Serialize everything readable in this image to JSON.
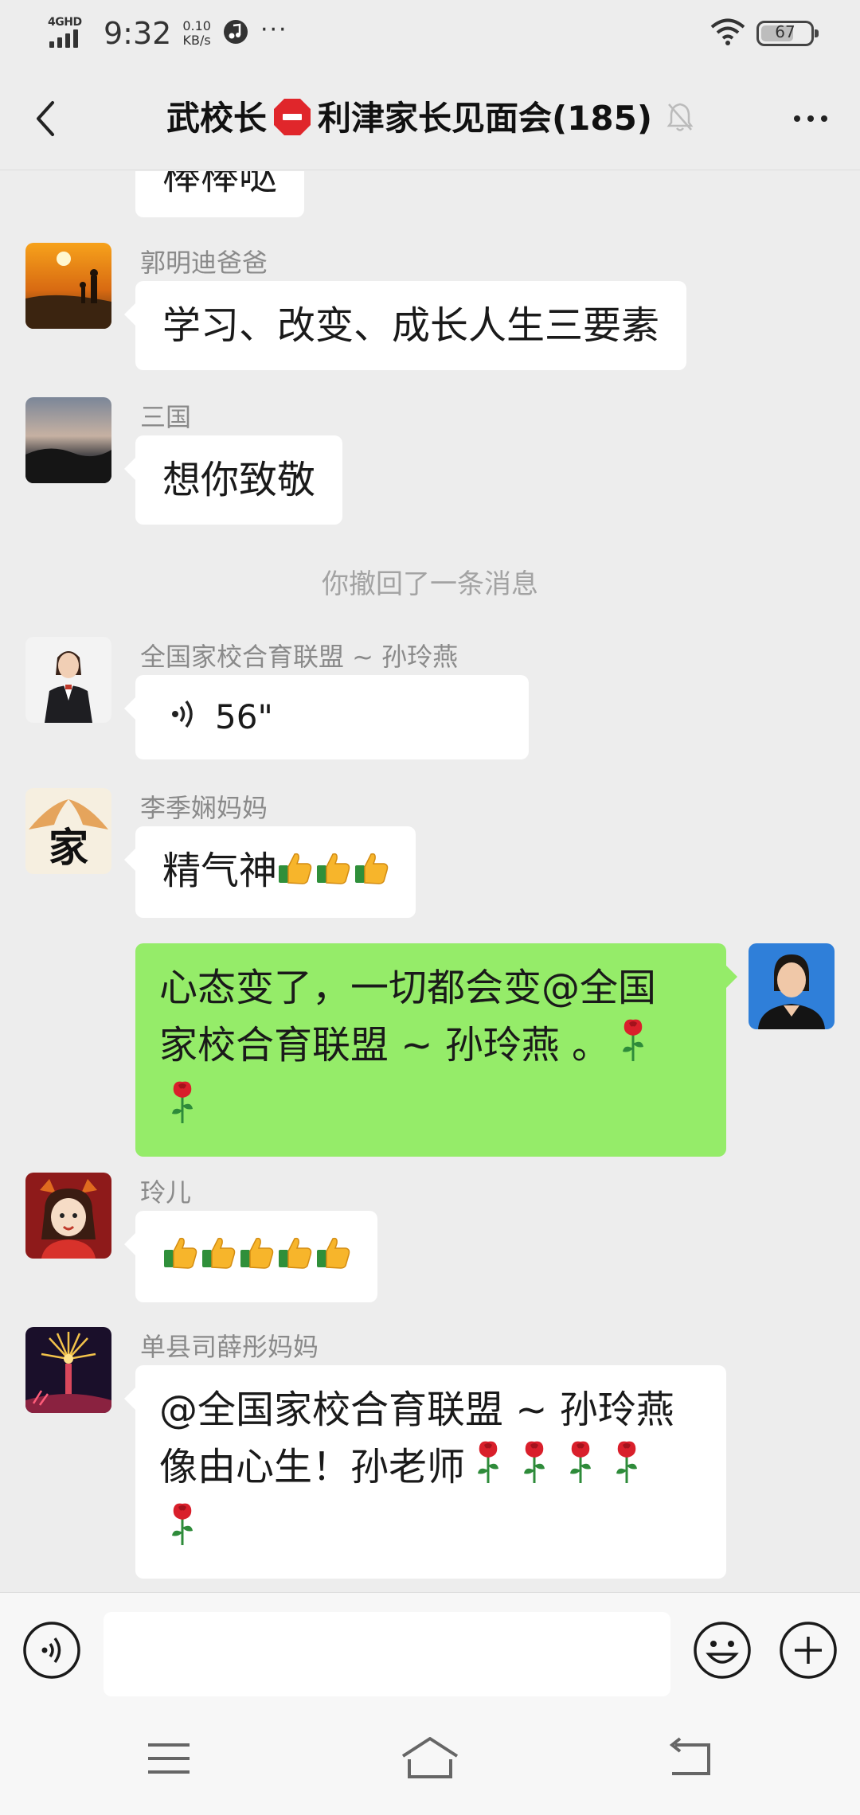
{
  "status_bar": {
    "network": "4GHD",
    "time": "9:32",
    "speed_value": "0.10",
    "speed_unit": "KB/s",
    "more": "···",
    "battery_level": "67"
  },
  "header": {
    "title_left": "武校长",
    "title_right": "利津家长见面会(185)",
    "muted": true
  },
  "chat": {
    "partial_message": "棒棒哒",
    "messages": [
      {
        "sender": "郭明迪爸爸",
        "text": "学习、改变、成长人生三要素"
      },
      {
        "sender": "三国",
        "text": "想你致敬"
      },
      {
        "system": "你撤回了一条消息"
      },
      {
        "sender": "全国家校合育联盟 ~ 孙玲燕",
        "voice_duration": "56\""
      },
      {
        "sender": "李季娴妈妈",
        "text": "精气神",
        "emoji": [
          "thumbs-up",
          "thumbs-up",
          "thumbs-up"
        ]
      },
      {
        "self": true,
        "line1": "心态变了，一切都会变@全国",
        "line2": "家校合育联盟 ~ 孙玲燕 。",
        "emoji": [
          "rose",
          "rose"
        ]
      },
      {
        "sender": "玲儿",
        "emoji": [
          "thumbs-up",
          "thumbs-up",
          "thumbs-up",
          "thumbs-up",
          "thumbs-up"
        ]
      },
      {
        "sender": "单县司薛彤妈妈",
        "line1": "@全国家校合育联盟 ~ 孙玲燕",
        "line2": "像由心生！孙老师",
        "emoji": [
          "rose",
          "rose",
          "rose",
          "rose",
          "rose"
        ]
      }
    ],
    "avatar_glyph": "家"
  },
  "input": {
    "placeholder": ""
  },
  "colors": {
    "background": "#ededed",
    "self_bubble": "#95ec69",
    "other_bubble": "#ffffff"
  }
}
